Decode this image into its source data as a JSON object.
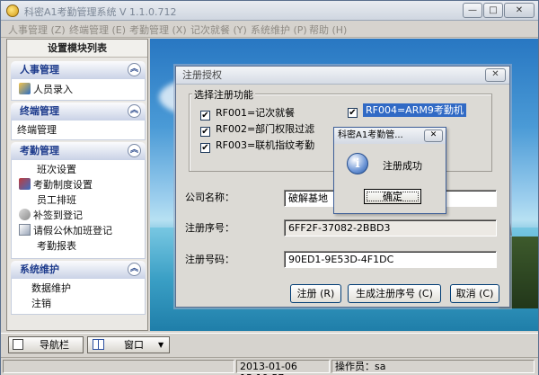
{
  "app": {
    "title": "科密A1考勤管理系统 V 1.1.0.712"
  },
  "window_controls": {
    "min": "—",
    "max": "□",
    "close": "✕"
  },
  "menu": [
    "人事管理 (Z)",
    "终端管理 (E)",
    "考勤管理 (X)",
    "记次就餐 (Y)",
    "系统维护 (P)",
    "帮助 (H)"
  ],
  "nav": {
    "title": "设置模块列表",
    "collapse_glyph": "︽",
    "sections": [
      {
        "title": "人事管理",
        "items": [
          "人员录入"
        ]
      },
      {
        "title": "终端管理",
        "items": [
          "终端管理"
        ]
      },
      {
        "title": "考勤管理",
        "items": [
          "班次设置",
          "考勤制度设置",
          "员工排班",
          "补签到登记",
          "请假公休加班登记",
          "考勤报表"
        ]
      },
      {
        "title": "系统维护",
        "items": [
          "数据维护",
          "注销"
        ]
      }
    ]
  },
  "bottom": {
    "nav_button": "导航栏",
    "window_button": "窗口",
    "dropdown_arrow": "▼"
  },
  "status": {
    "datetime": "2013-01-06 15:19:57",
    "operator_label": "操作员：",
    "operator": "sa"
  },
  "dialog": {
    "title": "注册授权",
    "close": "✕",
    "group_label": "选择注册功能",
    "features": [
      {
        "label": "RF001=记次就餐",
        "checked": true
      },
      {
        "label": "RF002=部门权限过滤",
        "checked": true
      },
      {
        "label": "RF003=联机指纹考勤",
        "checked": true
      },
      {
        "label": "RF004=ARM9考勤机",
        "checked": true
      }
    ],
    "check_glyph": "✔",
    "company_label": "公司名称：",
    "company_value": "破解基地",
    "serial_label": "注册序号：",
    "serial_value": "6FF2F-37082-2BBD3",
    "regcode_label": "注册号码：",
    "regcode_value": "90ED1-9E53D-4F1DC",
    "btn_register": "注册 (R)",
    "btn_generate": "生成注册序号 (C)",
    "btn_cancel": "取消 (C)"
  },
  "msgbox": {
    "title": "科密A1考勤管...",
    "close": "✕",
    "icon": "i",
    "text": "注册成功",
    "ok": "确定"
  }
}
